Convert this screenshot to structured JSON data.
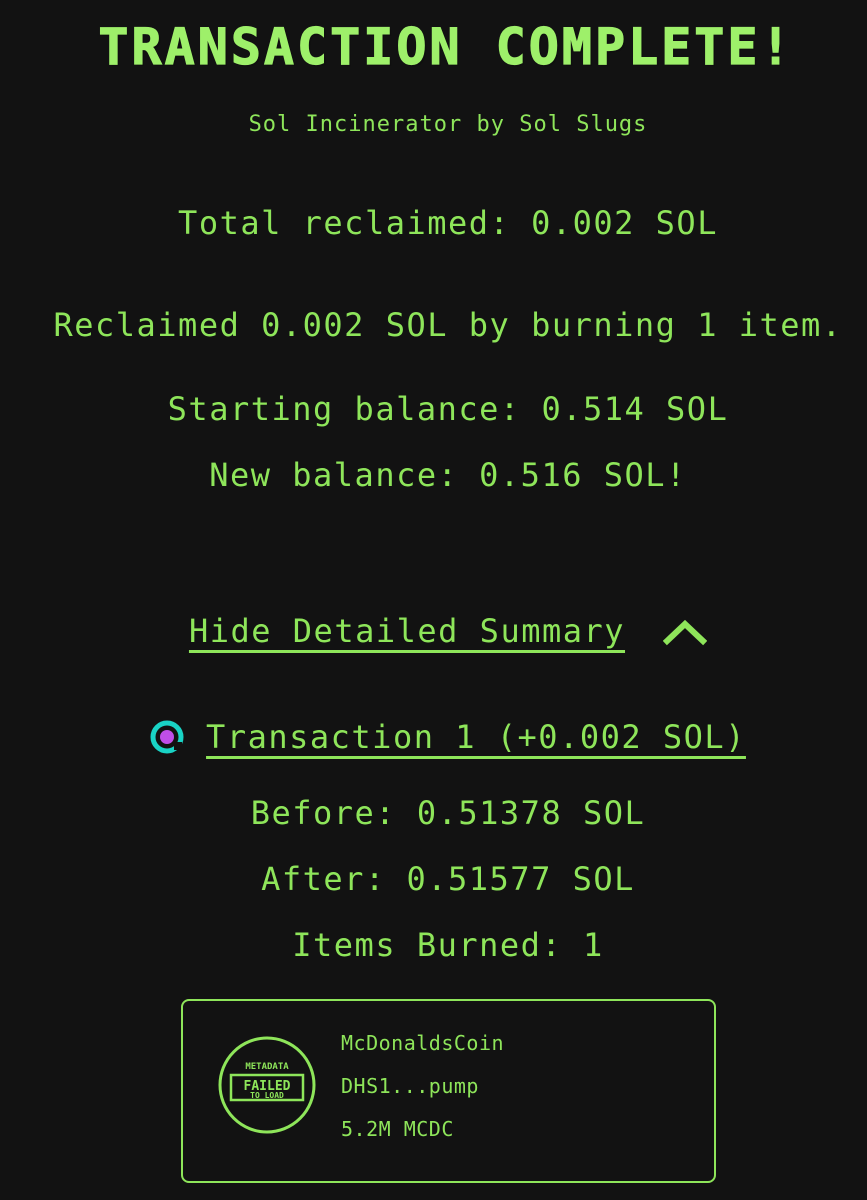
{
  "header": {
    "title": "TRANSACTION COMPLETE!",
    "subtitle": "Sol Incinerator by Sol Slugs"
  },
  "summary": {
    "total_reclaimed": "Total reclaimed: 0.002 SOL",
    "reclaimed_message": "Reclaimed 0.002 SOL by burning 1 item.",
    "starting_balance": "Starting balance: 0.514 SOL",
    "new_balance": "New balance: 0.516 SOL!"
  },
  "details_toggle": {
    "label": "Hide Detailed Summary",
    "icon": "chevron-up-icon"
  },
  "transaction": {
    "label": "Transaction 1 (+0.002 SOL)",
    "icon": "solscan-icon",
    "before": "Before: 0.51378 SOL",
    "after": "After: 0.51577 SOL",
    "items_burned": "Items Burned: 1"
  },
  "burned_item": {
    "image_status_top": "METADATA",
    "image_status_middle": "FAILED",
    "image_status_bottom": "TO LOAD",
    "name": "McDonaldsCoin",
    "address": "DHS1...pump",
    "amount": "5.2M MCDC"
  },
  "colors": {
    "background": "#121212",
    "accent": "#8ee55a",
    "icon_teal": "#19d3c5",
    "icon_magenta": "#c04ee8"
  }
}
